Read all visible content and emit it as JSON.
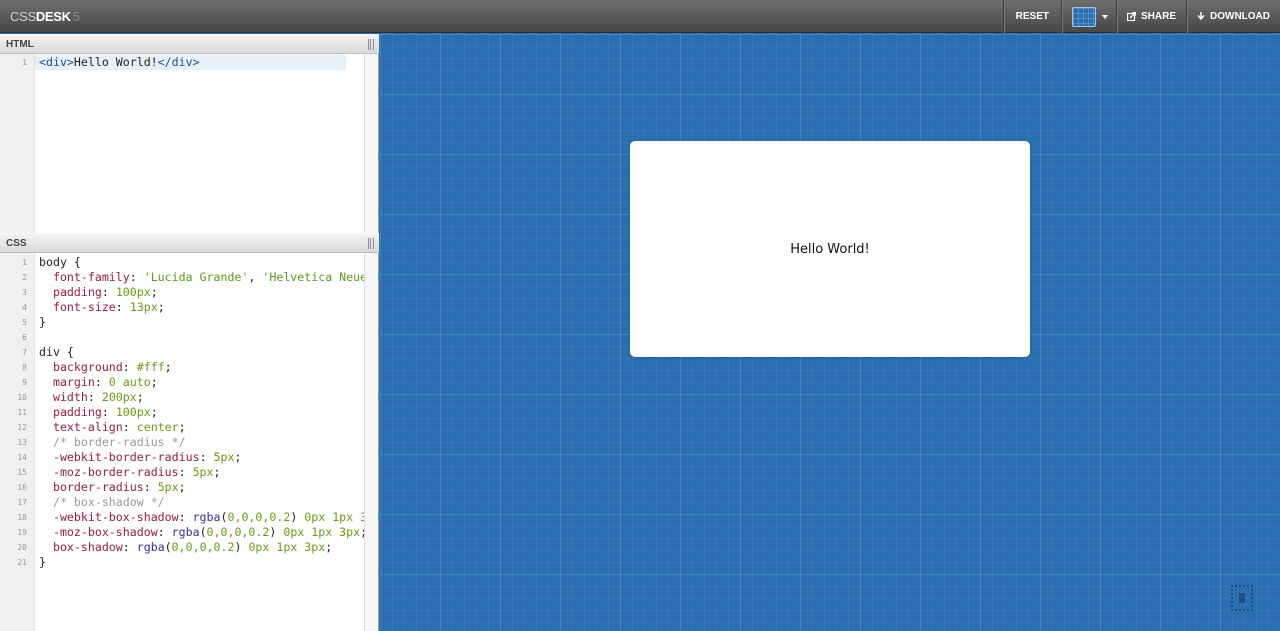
{
  "app": {
    "logo_part1": "CSS",
    "logo_part2": "DESK",
    "logo_part3": "5"
  },
  "toolbar": {
    "reset_label": "RESET",
    "share_label": "SHARE",
    "download_label": "DOWNLOAD",
    "background_swatch_color": "#2a6fb0"
  },
  "html_pane": {
    "title": "HTML",
    "line_numbers": [
      "1"
    ],
    "lines": [
      [
        {
          "t": "tg",
          "s": "<div>"
        },
        {
          "t": "",
          "s": "Hello World!"
        },
        {
          "t": "tg",
          "s": "</div>"
        }
      ]
    ]
  },
  "css_pane": {
    "title": "CSS",
    "line_numbers": [
      "1",
      "2",
      "3",
      "4",
      "5",
      "6",
      "7",
      "8",
      "9",
      "10",
      "11",
      "12",
      "13",
      "14",
      "15",
      "16",
      "17",
      "18",
      "19",
      "20",
      "21"
    ],
    "lines": [
      [
        {
          "t": "",
          "s": "body {"
        }
      ],
      [
        {
          "t": "",
          "s": "  "
        },
        {
          "t": "k",
          "s": "font-family"
        },
        {
          "t": "",
          "s": ": "
        },
        {
          "t": "s",
          "s": "'Lucida Grande'"
        },
        {
          "t": "",
          "s": ", "
        },
        {
          "t": "s",
          "s": "'Helvetica Neue'"
        }
      ],
      [
        {
          "t": "",
          "s": "  "
        },
        {
          "t": "k",
          "s": "padding"
        },
        {
          "t": "",
          "s": ": "
        },
        {
          "t": "v",
          "s": "100px"
        },
        {
          "t": "",
          "s": ";"
        }
      ],
      [
        {
          "t": "",
          "s": "  "
        },
        {
          "t": "k",
          "s": "font-size"
        },
        {
          "t": "",
          "s": ": "
        },
        {
          "t": "v",
          "s": "13px"
        },
        {
          "t": "",
          "s": ";"
        }
      ],
      [
        {
          "t": "",
          "s": "}"
        }
      ],
      [
        {
          "t": "",
          "s": ""
        }
      ],
      [
        {
          "t": "",
          "s": "div {"
        }
      ],
      [
        {
          "t": "",
          "s": "  "
        },
        {
          "t": "k",
          "s": "background"
        },
        {
          "t": "",
          "s": ": "
        },
        {
          "t": "v",
          "s": "#fff"
        },
        {
          "t": "",
          "s": ";"
        }
      ],
      [
        {
          "t": "",
          "s": "  "
        },
        {
          "t": "k",
          "s": "margin"
        },
        {
          "t": "",
          "s": ": "
        },
        {
          "t": "v",
          "s": "0 auto"
        },
        {
          "t": "",
          "s": ";"
        }
      ],
      [
        {
          "t": "",
          "s": "  "
        },
        {
          "t": "k",
          "s": "width"
        },
        {
          "t": "",
          "s": ": "
        },
        {
          "t": "v",
          "s": "200px"
        },
        {
          "t": "",
          "s": ";"
        }
      ],
      [
        {
          "t": "",
          "s": "  "
        },
        {
          "t": "k",
          "s": "padding"
        },
        {
          "t": "",
          "s": ": "
        },
        {
          "t": "v",
          "s": "100px"
        },
        {
          "t": "",
          "s": ";"
        }
      ],
      [
        {
          "t": "",
          "s": "  "
        },
        {
          "t": "k",
          "s": "text-align"
        },
        {
          "t": "",
          "s": ": "
        },
        {
          "t": "v",
          "s": "center"
        },
        {
          "t": "",
          "s": ";"
        }
      ],
      [
        {
          "t": "",
          "s": "  "
        },
        {
          "t": "c",
          "s": "/* border-radius */"
        }
      ],
      [
        {
          "t": "",
          "s": "  "
        },
        {
          "t": "k",
          "s": "-webkit-border-radius"
        },
        {
          "t": "",
          "s": ": "
        },
        {
          "t": "v",
          "s": "5px"
        },
        {
          "t": "",
          "s": ";"
        }
      ],
      [
        {
          "t": "",
          "s": "  "
        },
        {
          "t": "k",
          "s": "-moz-border-radius"
        },
        {
          "t": "",
          "s": ": "
        },
        {
          "t": "v",
          "s": "5px"
        },
        {
          "t": "",
          "s": ";"
        }
      ],
      [
        {
          "t": "",
          "s": "  "
        },
        {
          "t": "k",
          "s": "border-radius"
        },
        {
          "t": "",
          "s": ": "
        },
        {
          "t": "v",
          "s": "5px"
        },
        {
          "t": "",
          "s": ";"
        }
      ],
      [
        {
          "t": "",
          "s": "  "
        },
        {
          "t": "c",
          "s": "/* box-shadow */"
        }
      ],
      [
        {
          "t": "",
          "s": "  "
        },
        {
          "t": "k",
          "s": "-webkit-box-shadow"
        },
        {
          "t": "",
          "s": ": "
        },
        {
          "t": "f",
          "s": "rgba"
        },
        {
          "t": "",
          "s": "("
        },
        {
          "t": "v",
          "s": "0,0,0,0.2"
        },
        {
          "t": "",
          "s": ") "
        },
        {
          "t": "v",
          "s": "0px 1px 3"
        }
      ],
      [
        {
          "t": "",
          "s": "  "
        },
        {
          "t": "k",
          "s": "-moz-box-shadow"
        },
        {
          "t": "",
          "s": ": "
        },
        {
          "t": "f",
          "s": "rgba"
        },
        {
          "t": "",
          "s": "("
        },
        {
          "t": "v",
          "s": "0,0,0,0.2"
        },
        {
          "t": "",
          "s": ") "
        },
        {
          "t": "v",
          "s": "0px 1px 3px"
        },
        {
          "t": "",
          "s": ";"
        }
      ],
      [
        {
          "t": "",
          "s": "  "
        },
        {
          "t": "k",
          "s": "box-shadow"
        },
        {
          "t": "",
          "s": ": "
        },
        {
          "t": "f",
          "s": "rgba"
        },
        {
          "t": "",
          "s": "("
        },
        {
          "t": "v",
          "s": "0,0,0,0.2"
        },
        {
          "t": "",
          "s": ") "
        },
        {
          "t": "v",
          "s": "0px 1px 3px"
        },
        {
          "t": "",
          "s": ";"
        }
      ],
      [
        {
          "t": "",
          "s": "}"
        }
      ]
    ]
  },
  "preview": {
    "content_text": "Hello World!",
    "background_color": "#2a6fb0"
  }
}
